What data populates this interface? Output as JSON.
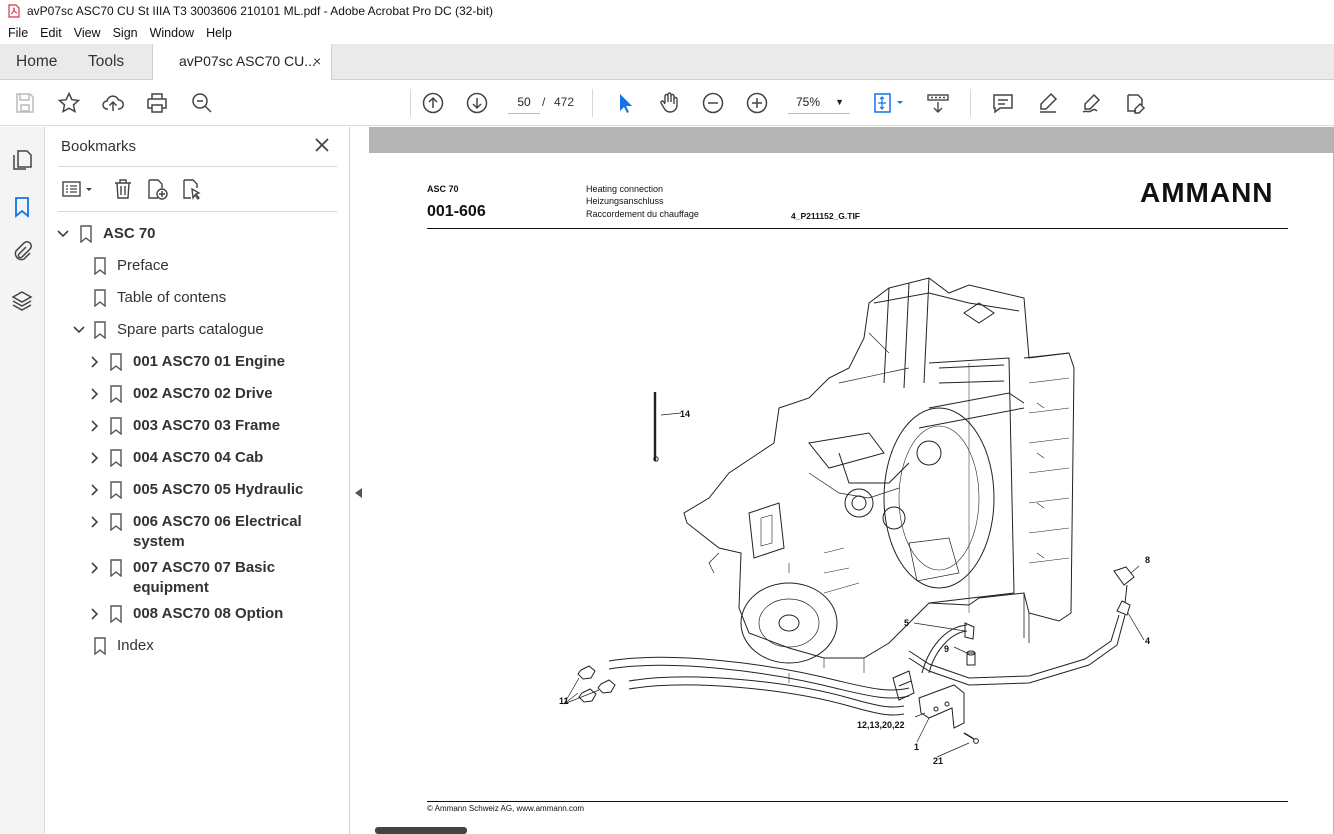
{
  "window": {
    "title": "avP07sc ASC70 CU St IIIA T3 3003606 210101 ML.pdf - Adobe Acrobat Pro DC (32-bit)"
  },
  "menu": [
    "File",
    "Edit",
    "View",
    "Sign",
    "Window",
    "Help"
  ],
  "tabs": {
    "home": "Home",
    "tools": "Tools",
    "document": "avP07sc ASC70 CU...",
    "close": "×"
  },
  "toolbar": {
    "page_current": "50",
    "page_separator": "/",
    "page_total": "472",
    "zoom": "75%",
    "zoom_caret": "▼",
    "icons": [
      "save-icon",
      "star-icon",
      "upload-icon",
      "print-icon",
      "zoom-search-icon",
      "page-up-icon",
      "page-down-icon",
      "select-cursor-icon",
      "hand-icon",
      "zoom-out-icon",
      "zoom-in-icon",
      "fit-page-icon",
      "scroll-mode-icon",
      "comment-icon",
      "highlight-icon",
      "draw-icon",
      "fill-sign-icon"
    ]
  },
  "bookmarks": {
    "header": "Bookmarks",
    "items": [
      {
        "label": "ASC 70",
        "bold": true,
        "level": 0,
        "chevron": "down"
      },
      {
        "label": "Preface",
        "bold": false,
        "level": 1,
        "chevron": "none"
      },
      {
        "label": "Table of contens",
        "bold": false,
        "level": 1,
        "chevron": "none"
      },
      {
        "label": "Spare parts catalogue",
        "bold": false,
        "level": 1,
        "chevron": "down"
      },
      {
        "label": "001 ASC70 01 Engine",
        "bold": true,
        "level": 2,
        "chevron": "right"
      },
      {
        "label": "002 ASC70 02 Drive",
        "bold": true,
        "level": 2,
        "chevron": "right"
      },
      {
        "label": "003 ASC70 03 Frame",
        "bold": true,
        "level": 2,
        "chevron": "right"
      },
      {
        "label": "004 ASC70 04 Cab",
        "bold": true,
        "level": 2,
        "chevron": "right"
      },
      {
        "label": "005 ASC70 05 Hydraulic",
        "bold": true,
        "level": 2,
        "chevron": "right"
      },
      {
        "label": "006 ASC70 06 Electrical system",
        "bold": true,
        "level": 2,
        "chevron": "right"
      },
      {
        "label": "007 ASC70 07 Basic equipment",
        "bold": true,
        "level": 2,
        "chevron": "right"
      },
      {
        "label": "008 ASC70 08 Option",
        "bold": true,
        "level": 2,
        "chevron": "right"
      },
      {
        "label": "Index",
        "bold": false,
        "level": 1,
        "chevron": "none"
      }
    ]
  },
  "document": {
    "model": "ASC 70",
    "doc_number": "001-606",
    "title_en": "Heating connection",
    "title_de": "Heizungsanschluss",
    "title_fr": "Raccordement du chauffage",
    "image_ref": "4_P211152_G.TIF",
    "brand": "AMMANN",
    "footer": "© Ammann Schweiz AG, www.ammann.com",
    "callouts": {
      "c14": "14",
      "c8": "8",
      "c5": "5",
      "c9": "9",
      "c4": "4",
      "c11": "11",
      "c12": "12,13,20,22",
      "c1": "1",
      "c21": "21"
    }
  },
  "colors": {
    "tab_bar": "#eaeaea",
    "viewer_bg": "#b4b4b4",
    "accent_blue": "#1473e6",
    "pdf_red": "#d7373f"
  }
}
